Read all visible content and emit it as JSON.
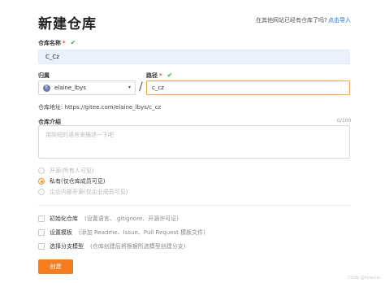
{
  "page": {
    "title": "新建仓库",
    "import_question": "在其他网站已经有仓库了吗?",
    "import_link": "点击导入"
  },
  "repo_name": {
    "label": "仓库名称",
    "required_mark": "*",
    "valid_mark": "✔",
    "value": "C_Cz"
  },
  "owner": {
    "label": "归属",
    "avatar_letter": "E",
    "value": "elaine_lbys",
    "caret": "▾"
  },
  "separator": "/",
  "path": {
    "label": "路径",
    "required_mark": "*",
    "valid_mark": "✔",
    "value": "c_cz"
  },
  "address": {
    "label": "仓库地址:",
    "url": "https://gitee.com/elaine_lbys/c_cz"
  },
  "description": {
    "label": "仓库介绍",
    "counter": "0/100",
    "placeholder": "用简短的语言来描述一下吧"
  },
  "visibility": {
    "options": [
      {
        "label": "开源",
        "hint": "(所有人可见)",
        "selected": false,
        "disabled": true
      },
      {
        "label": "私有",
        "hint": "(仅仓库成员可见)",
        "selected": true,
        "disabled": false
      },
      {
        "label": "企业内部开源",
        "hint": "(仅企业成员可见)",
        "selected": false,
        "disabled": true
      }
    ]
  },
  "options": [
    {
      "label": "初始化仓库",
      "hint": "(设置语言、.gitignore、开源许可证)"
    },
    {
      "label": "设置模板",
      "hint": "(添加 Readme、Issue、Pull Request 模板文件)"
    },
    {
      "label": "选择分支模型",
      "hint": "(仓库创建后将根据所选模型创建分支)"
    }
  ],
  "actions": {
    "create_label": "创建"
  },
  "watermark": "CSDN @Pxiaoliu"
}
